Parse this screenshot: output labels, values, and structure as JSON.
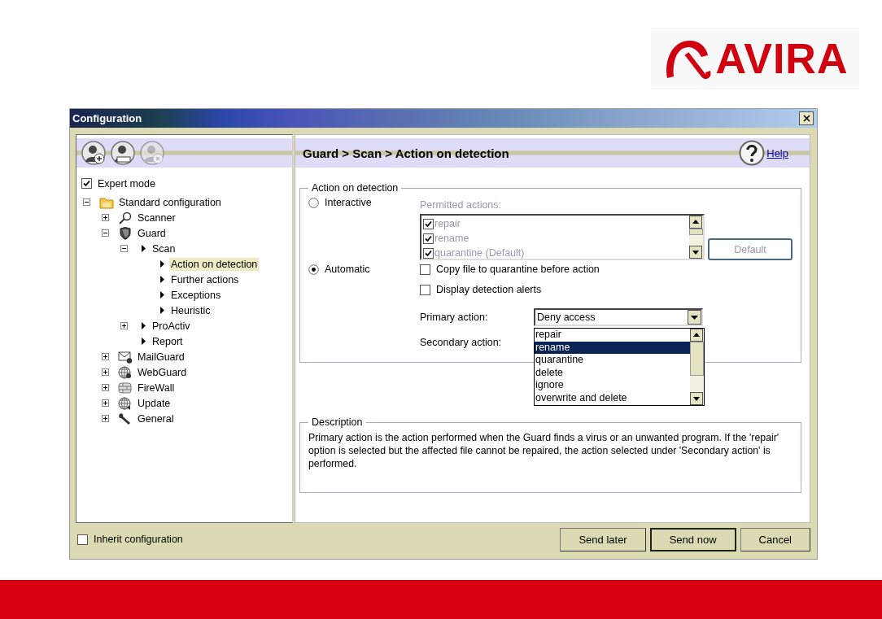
{
  "logo": {
    "text": "AVIRA"
  },
  "window": {
    "title": "Configuration"
  },
  "toolbar": [
    {
      "kind": "add",
      "disabled": false
    },
    {
      "kind": "profile",
      "disabled": false
    },
    {
      "kind": "remove",
      "disabled": true
    }
  ],
  "expert_mode": {
    "label": "Expert mode",
    "checked": true
  },
  "tree": [
    {
      "label": "Standard configuration",
      "kind": "folder",
      "expanded": true,
      "selected": false,
      "children": [
        {
          "label": "Scanner",
          "kind": "search",
          "expanded": false,
          "selected": false
        },
        {
          "label": "Guard",
          "kind": "shield",
          "expanded": true,
          "selected": false,
          "children": [
            {
              "label": "Scan",
              "kind": "arrow",
              "expanded": true,
              "selected": false,
              "children": [
                {
                  "label": "Action on detection",
                  "kind": "arrow",
                  "selected": true
                },
                {
                  "label": "Further actions",
                  "kind": "arrow",
                  "selected": false
                },
                {
                  "label": "Exceptions",
                  "kind": "arrow",
                  "selected": false
                },
                {
                  "label": "Heuristic",
                  "kind": "arrow",
                  "selected": false
                }
              ]
            },
            {
              "label": "ProActiv",
              "kind": "arrow",
              "expanded": false,
              "selected": false
            },
            {
              "label": "Report",
              "kind": "arrow",
              "selected": false
            }
          ]
        },
        {
          "label": "MailGuard",
          "kind": "mail",
          "expanded": false,
          "selected": false
        },
        {
          "label": "WebGuard",
          "kind": "globe",
          "expanded": false,
          "selected": false
        },
        {
          "label": "FireWall",
          "kind": "wall",
          "expanded": false,
          "selected": false
        },
        {
          "label": "Update",
          "kind": "update",
          "expanded": false,
          "selected": false
        },
        {
          "label": "General",
          "kind": "wrench",
          "expanded": false,
          "selected": false
        }
      ]
    }
  ],
  "header": {
    "breadcrumb": "Guard > Scan > Action on detection",
    "help": "Help"
  },
  "action_group": {
    "title": "Action on detection",
    "modes": [
      {
        "label": "Interactive",
        "selected": false
      },
      {
        "label": "Automatic",
        "selected": true
      }
    ],
    "permitted": {
      "label": "Permitted actions:",
      "disabled": true,
      "items": [
        {
          "label": "repair",
          "checked": true
        },
        {
          "label": "rename",
          "checked": true
        },
        {
          "label": "quarantine (Default)",
          "checked": true
        }
      ]
    },
    "default_button": {
      "label": "Default",
      "disabled": true
    },
    "options": [
      {
        "label": "Copy file to quarantine before action",
        "checked": false
      },
      {
        "label": "Display detection alerts",
        "checked": false
      }
    ],
    "primary": {
      "label": "Primary action:",
      "value": "Deny access"
    },
    "secondary": {
      "label": "Secondary action:",
      "options": [
        {
          "label": "repair",
          "selected": false
        },
        {
          "label": "rename",
          "selected": true
        },
        {
          "label": "quarantine",
          "selected": false
        },
        {
          "label": "delete",
          "selected": false
        },
        {
          "label": "ignore",
          "selected": false
        },
        {
          "label": "overwrite and delete",
          "selected": false
        }
      ]
    }
  },
  "description": {
    "title": "Description",
    "text": "Primary action is the action performed when the Guard finds a virus or an unwanted program. If the 'repair' option is selected but the affected file cannot be repaired, the action selected under 'Secondary action' is performed."
  },
  "inherit": {
    "label": "Inherit configuration",
    "checked": false
  },
  "buttons": [
    {
      "label": "Send later",
      "default": false
    },
    {
      "label": "Send now",
      "default": true
    },
    {
      "label": "Cancel",
      "default": false
    }
  ]
}
